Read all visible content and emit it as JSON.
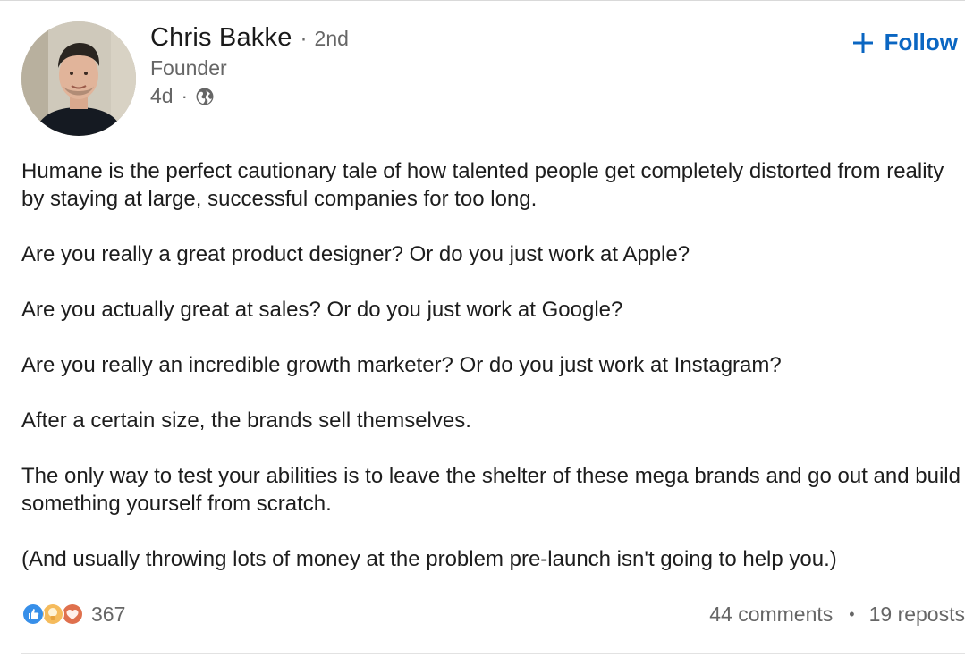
{
  "author": {
    "name": "Chris Bakke",
    "separator": "·",
    "degree": "2nd",
    "headline": "Founder",
    "time_ago": "4d",
    "visibility_icon": "globe-icon",
    "avatar_icon": "avatar"
  },
  "follow": {
    "icon": "plus-icon",
    "label": "Follow",
    "color": "#0a66c2"
  },
  "post": {
    "paragraphs": [
      "Humane is the perfect cautionary tale of how talented people get completely distorted from reality by staying at large, successful companies for too long.",
      "Are you really a great product designer? Or do you just work at Apple?",
      "Are you actually great at sales? Or do you just work at Google?",
      "Are you really an incredible growth marketer? Or do you just work at Instagram?",
      "After a certain size, the brands sell themselves.",
      "The only way to test your abilities is to leave the shelter of these mega brands and go out and build something yourself from scratch.",
      "(And usually throwing lots of money at the problem pre-launch isn't going to help you.)"
    ]
  },
  "social": {
    "reaction_icons": [
      "like-icon",
      "insightful-icon",
      "love-icon"
    ],
    "reaction_count": "367",
    "comments": "44 comments",
    "dot": "•",
    "reposts": "19 reposts"
  },
  "colors": {
    "link_blue": "#0a66c2",
    "secondary_text": "#666666",
    "body_text": "#1d1d1d"
  }
}
